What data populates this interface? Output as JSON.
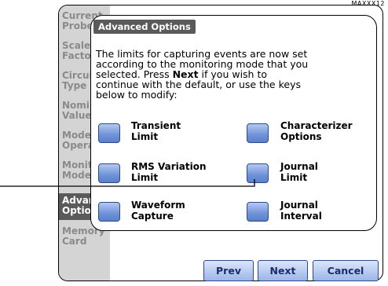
{
  "corner_label": "MAXXX12",
  "sidebar": {
    "items": [
      {
        "label": "Current\nProbe"
      },
      {
        "label": "Scale\nFactors"
      },
      {
        "label": "Circuit\nType"
      },
      {
        "label": "Nominal\nValues"
      },
      {
        "label": "Mode of\nOperation"
      },
      {
        "label": "Monitoring\nMode"
      },
      {
        "label": "Advanced\nOptions"
      },
      {
        "label": "Memory\nCard"
      }
    ],
    "active_item": "Advanced Options"
  },
  "panel": {
    "title": "Advanced Options",
    "text_line1": "The limits for capturing events are now set",
    "text_line2": "according to the monitoring mode that you",
    "text_line3_pre": "selected. Press ",
    "text_line3_bold": "Next",
    "text_line3_post": " if you wish to",
    "text_line4": "continue with the default, or use the keys",
    "text_line5": "below to modify:"
  },
  "options": [
    {
      "label": "Transient\nLimit"
    },
    {
      "label": "Characterizer\nOptions"
    },
    {
      "label": "RMS Variation\nLimit"
    },
    {
      "label": "Journal\nLimit"
    },
    {
      "label": "Waveform\nCapture"
    },
    {
      "label": "Journal\nInterval"
    }
  ],
  "nav": {
    "prev": "Prev",
    "next": "Next",
    "cancel": "Cancel"
  },
  "colors": {
    "sidebar_bg": "#d4d4d4",
    "active_bg": "#5a5a5a",
    "button_blue": "#6f92d8",
    "nav_text": "#1a2d6b"
  }
}
